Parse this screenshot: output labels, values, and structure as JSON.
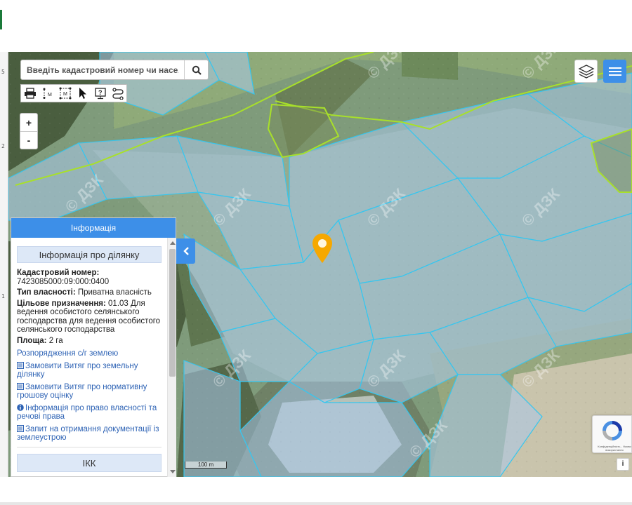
{
  "search": {
    "placeholder": "Введіть кадастровий номер чи населений пункт"
  },
  "toolbar": {
    "tools": [
      "printer-icon",
      "measure-line-icon",
      "measure-area-icon",
      "pointer-icon",
      "help-icon",
      "route-icon"
    ]
  },
  "zoom": {
    "in_label": "+",
    "out_label": "-"
  },
  "map": {
    "watermark": "© ДЗК",
    "scale_label": "100 m",
    "info_label": "i",
    "recaptcha_text": "Конфіденційність - Умови використання",
    "colors": {
      "parcel_fill": "#a9c7e6",
      "parcel_border": "#36c6ee",
      "settlement_border": "#a8e02a",
      "marker": "#f6a800"
    }
  },
  "info_panel": {
    "header": "Інформація",
    "section_title": "Інформація про ділянку",
    "cadastral_label": "Кадастровий номер:",
    "cadastral_value": "7423085000:09:000:0400",
    "ownership_label": "Тип власності:",
    "ownership_value": "Приватна власність",
    "purpose_label": "Цільове призначення:",
    "purpose_value": "01.03 Для ведення особистого селянського господарства для ведення особистого селянського господарства",
    "area_label": "Площа:",
    "area_value": "2 га",
    "links": {
      "disposal": "Розпорядження с/г землею",
      "order_extract": "Замовити Витяг про земельну ділянку",
      "order_valuation": "Замовити Витяг про нормативну грошову оцінку",
      "ownership_info": "Інформація про право власності та речові права",
      "docs_request": "Запит на отримання документації із землеустрою"
    },
    "ikk_label": "ІКК"
  },
  "left_strip": {
    "marks": [
      "5",
      "2",
      "1"
    ]
  }
}
